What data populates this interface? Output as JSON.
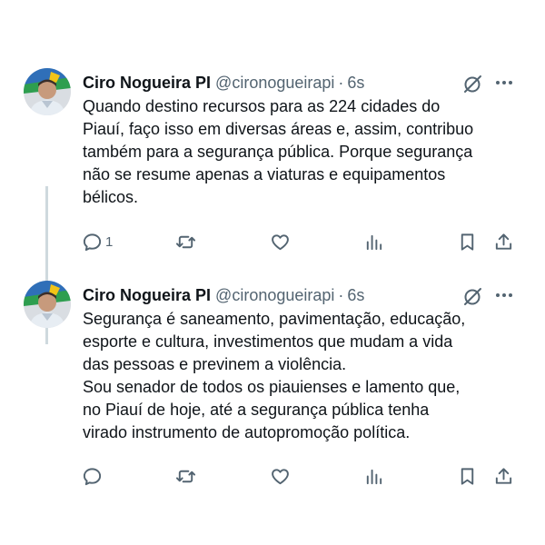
{
  "colors": {
    "name": "#0f1419",
    "secondary": "#536471",
    "thread_line": "#cfd9de"
  },
  "tweets": [
    {
      "author": "Ciro Nogueira PI",
      "handle": "@cironogueirapi",
      "separator": "·",
      "time": "6s",
      "lines": [
        "Quando destino recursos para as 224 cidades do",
        "Piauí, faço isso em diversas áreas e, assim, contribuo",
        "também para a segurança pública. Porque segurança",
        "não se resume apenas a viaturas e equipamentos",
        "bélicos."
      ],
      "reply_count": "1",
      "icons": [
        "avatar",
        "grok-icon",
        "more-icon",
        "reply-icon",
        "retweet-icon",
        "like-icon",
        "views-icon",
        "bookmark-icon",
        "share-icon"
      ]
    },
    {
      "author": "Ciro Nogueira PI",
      "handle": "@cironogueirapi",
      "separator": "·",
      "time": "6s",
      "lines": [
        "Segurança é saneamento, pavimentação, educação,",
        "esporte e cultura, investimentos que mudam a vida",
        "das pessoas e previnem a violência.",
        "Sou senador de todos os piauienses e lamento que,",
        "no Piauí de hoje, até a segurança pública tenha",
        "virado instrumento de autopromoção política."
      ],
      "reply_count": "",
      "icons": [
        "avatar",
        "grok-icon",
        "more-icon",
        "reply-icon",
        "retweet-icon",
        "like-icon",
        "views-icon",
        "bookmark-icon",
        "share-icon"
      ]
    }
  ]
}
